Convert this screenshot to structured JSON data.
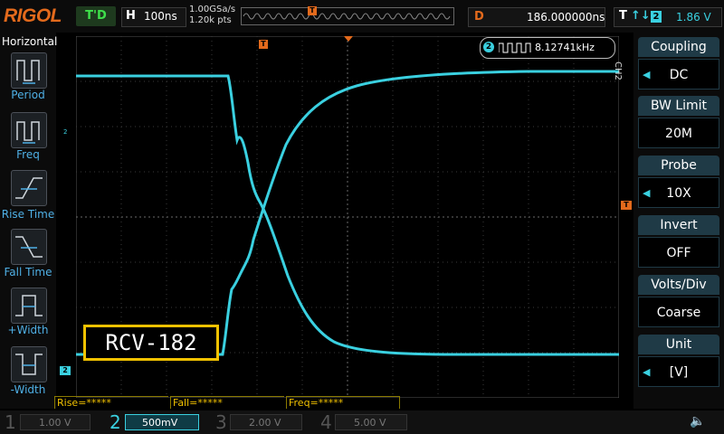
{
  "top": {
    "logo": "RIGOL",
    "trig_status": "T'D",
    "horizontal": {
      "letter": "H",
      "value": "100ns"
    },
    "sample_rate": "1.00GSa/s",
    "points": "1.20k pts",
    "delay": {
      "letter": "D",
      "value": "186.000000ns"
    },
    "trigger": {
      "letter": "T",
      "edge": "↑↓",
      "source": "2",
      "level": "1.86 V"
    }
  },
  "left_menu": {
    "title": "Horizontal",
    "items": [
      {
        "label": "Period",
        "icon": "period-icon"
      },
      {
        "label": "Freq",
        "icon": "freq-icon"
      },
      {
        "label": "Rise Time",
        "icon": "rise-time-icon"
      },
      {
        "label": "Fall Time",
        "icon": "fall-time-icon"
      },
      {
        "label": "+Width",
        "icon": "pos-width-icon"
      },
      {
        "label": "-Width",
        "icon": "neg-width-icon"
      }
    ]
  },
  "screen": {
    "trigger_marker": "T",
    "channel_marker": "2",
    "freq_badge": {
      "channel": "2",
      "value": "8.12741kHz"
    },
    "label": "RCV-182"
  },
  "right_menu": {
    "channel_tag": "CH2",
    "items": [
      {
        "title": "Coupling",
        "value": "DC",
        "arrow": true
      },
      {
        "title": "BW Limit",
        "value": "20M",
        "arrow": false
      },
      {
        "title": "Probe",
        "value": "10X",
        "arrow": true
      },
      {
        "title": "Invert",
        "value": "OFF",
        "arrow": false
      },
      {
        "title": "Volts/Div",
        "value": "Coarse",
        "arrow": false
      },
      {
        "title": "Unit",
        "value": "[V]",
        "arrow": true
      }
    ]
  },
  "measurements": [
    {
      "label": "Rise=*****"
    },
    {
      "label": "Fall=*****"
    },
    {
      "label": "Freq=*****"
    }
  ],
  "channels": [
    {
      "num": "1",
      "scale": "1.00 V"
    },
    {
      "num": "2",
      "scale": "500mV"
    },
    {
      "num": "3",
      "scale": "2.00 V"
    },
    {
      "num": "4",
      "scale": "5.00 V"
    }
  ],
  "colors": {
    "ch2": "#3ad0e0",
    "trigger": "#e36a1c",
    "label_border": "#f2c200"
  }
}
